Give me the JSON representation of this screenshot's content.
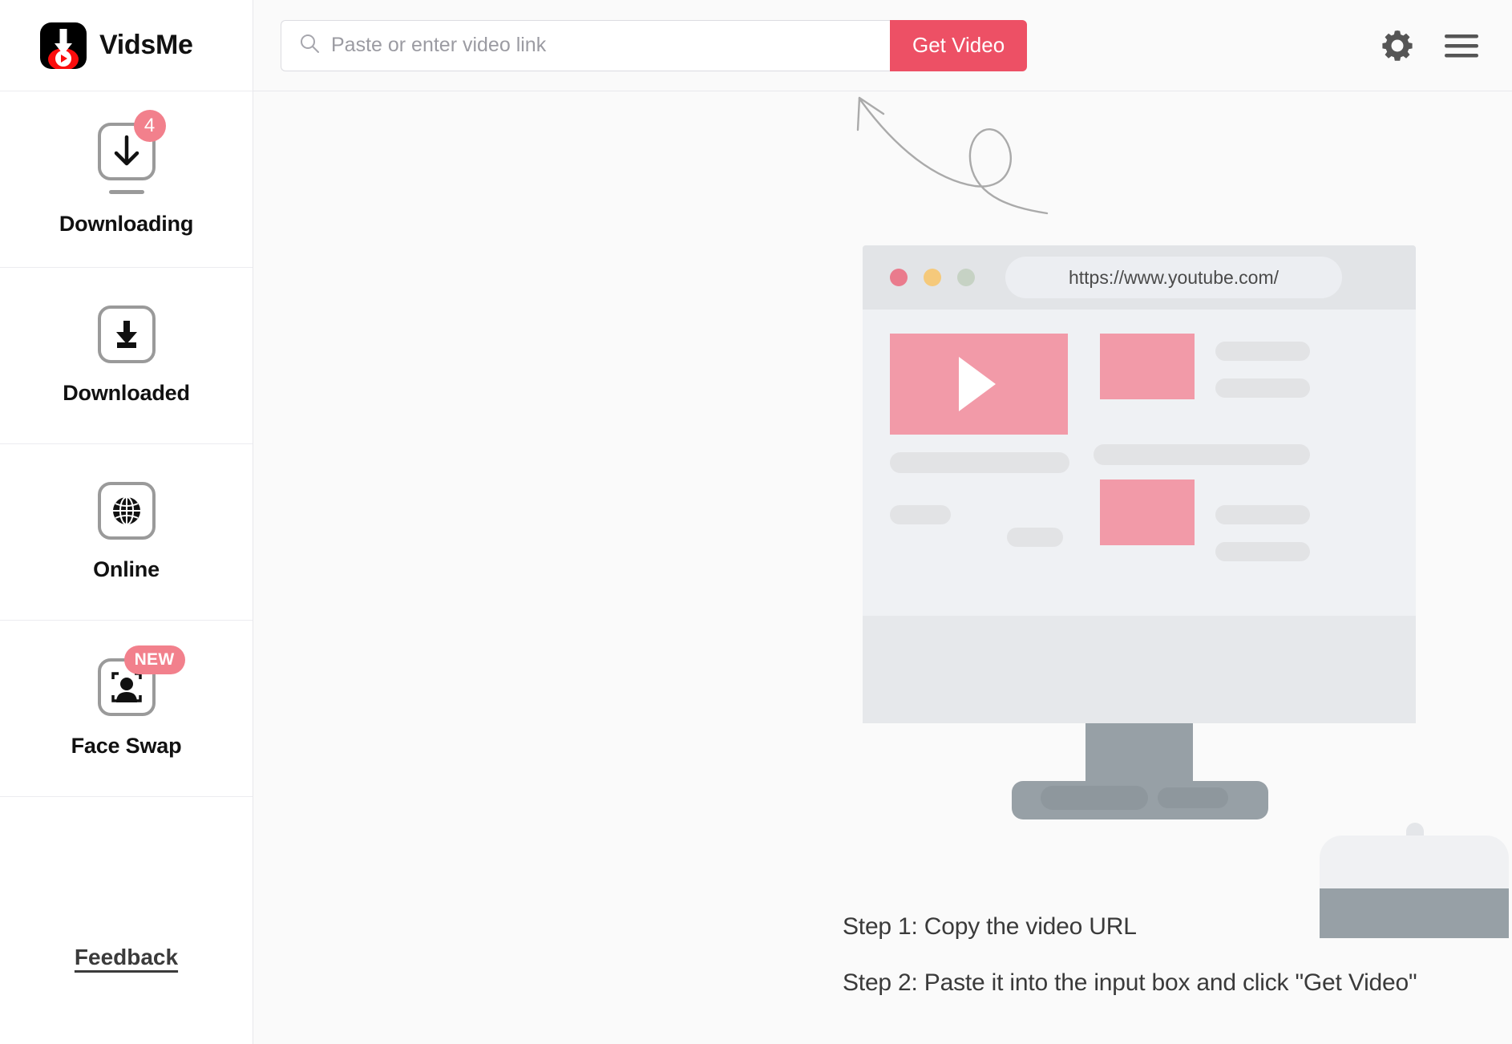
{
  "brand": {
    "name": "VidsMe",
    "logo_icon": "vidsme-download-play-logo"
  },
  "sidebar": {
    "items": [
      {
        "label": "Downloading",
        "icon": "download-arrow-outline-icon",
        "badge": "4",
        "badge_type": "count"
      },
      {
        "label": "Downloaded",
        "icon": "download-tray-filled-icon",
        "badge": "",
        "badge_type": "none"
      },
      {
        "label": "Online",
        "icon": "globe-icon",
        "badge": "",
        "badge_type": "none"
      },
      {
        "label": "Face Swap",
        "icon": "face-detect-icon",
        "badge": "NEW",
        "badge_type": "tag"
      }
    ],
    "feedback_label": "Feedback"
  },
  "topbar": {
    "search_placeholder": "Paste or enter video link",
    "search_value": "",
    "search_icon": "search-icon",
    "get_video_label": "Get Video",
    "settings_icon": "gear-icon",
    "menu_icon": "hamburger-menu-icon"
  },
  "illustration": {
    "browser_url": "https://www.youtube.com/",
    "dot_colors": [
      "#ea7b8d",
      "#f5c97b",
      "#c6d2c4"
    ],
    "arrow_icon": "hand-drawn-curved-arrow-icon",
    "play_icon": "play-triangle-icon"
  },
  "steps": [
    "Step 1: Copy the video URL",
    "Step 2: Paste it into the input box and click \"Get Video\""
  ],
  "colors": {
    "accent": "#ed5065",
    "badge": "#f2808c",
    "pink_block": "#f29aa8",
    "gray_bar": "#e2e3e5",
    "monitor_gray": "#97a0a6"
  }
}
